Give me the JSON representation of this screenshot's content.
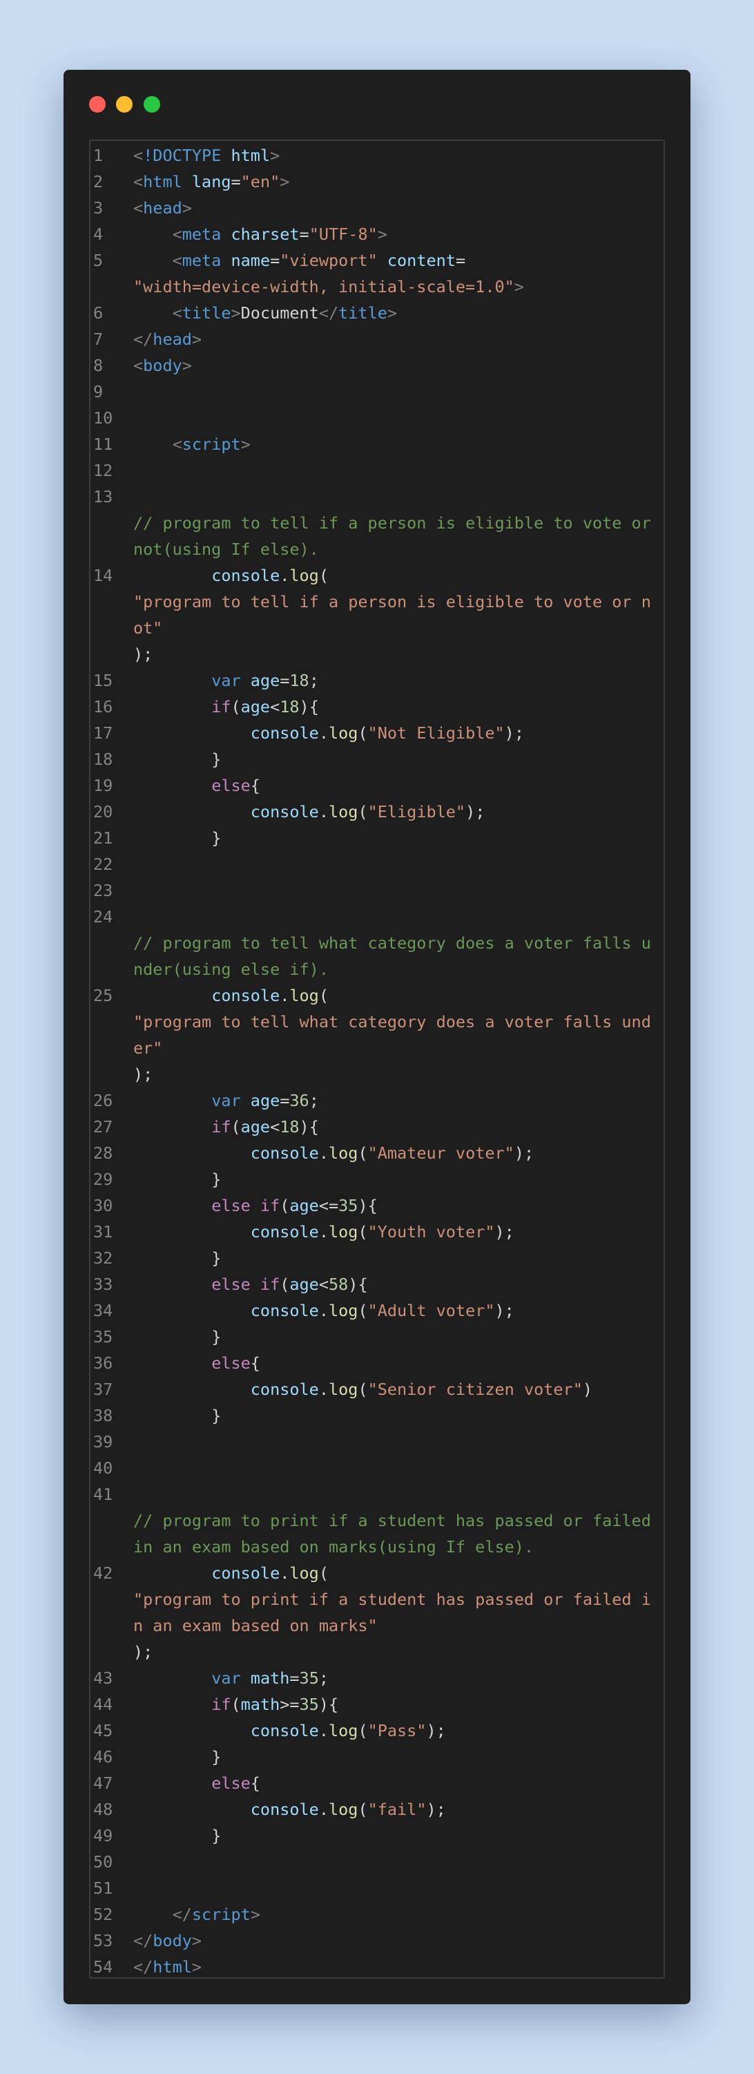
{
  "window": {
    "buttons": [
      "close",
      "minimize",
      "maximize"
    ]
  },
  "editor": {
    "colors": {
      "background": "#1e1e1e",
      "comment": "#6a9955",
      "string": "#ce9178",
      "keyword": "#569cd6",
      "control": "#c586c0",
      "number": "#b5cea8",
      "function": "#dcdcaa",
      "variable": "#9cdcfe"
    },
    "lines": [
      {
        "n": "1",
        "tokens": [
          [
            "bracket",
            "<"
          ],
          [
            "tag",
            "!DOCTYPE"
          ],
          [
            "text",
            " "
          ],
          [
            "attr",
            "html"
          ],
          [
            "bracket",
            ">"
          ]
        ]
      },
      {
        "n": "2",
        "tokens": [
          [
            "bracket",
            "<"
          ],
          [
            "tag",
            "html"
          ],
          [
            "text",
            " "
          ],
          [
            "attr",
            "lang"
          ],
          [
            "punc",
            "="
          ],
          [
            "str",
            "\"en\""
          ],
          [
            "bracket",
            ">"
          ]
        ]
      },
      {
        "n": "3",
        "tokens": [
          [
            "bracket",
            "<"
          ],
          [
            "tag",
            "head"
          ],
          [
            "bracket",
            ">"
          ]
        ]
      },
      {
        "n": "4",
        "tokens": [
          [
            "text",
            "    "
          ],
          [
            "bracket",
            "<"
          ],
          [
            "tag",
            "meta"
          ],
          [
            "text",
            " "
          ],
          [
            "attr",
            "charset"
          ],
          [
            "punc",
            "="
          ],
          [
            "str",
            "\"UTF-8\""
          ],
          [
            "bracket",
            ">"
          ]
        ]
      },
      {
        "n": "5",
        "tokens": [
          [
            "text",
            "    "
          ],
          [
            "bracket",
            "<"
          ],
          [
            "tag",
            "meta"
          ],
          [
            "text",
            " "
          ],
          [
            "attr",
            "name"
          ],
          [
            "punc",
            "="
          ],
          [
            "str",
            "\"viewport\""
          ],
          [
            "text",
            " "
          ],
          [
            "attr",
            "content"
          ],
          [
            "punc",
            "="
          ],
          [
            "text",
            "\n"
          ],
          [
            "str",
            "\"width=device-width, initial-scale=1.0\""
          ],
          [
            "bracket",
            ">"
          ]
        ]
      },
      {
        "n": "6",
        "tokens": [
          [
            "text",
            "    "
          ],
          [
            "bracket",
            "<"
          ],
          [
            "tag",
            "title"
          ],
          [
            "bracket",
            ">"
          ],
          [
            "text",
            "Document"
          ],
          [
            "bracket",
            "</"
          ],
          [
            "tag",
            "title"
          ],
          [
            "bracket",
            ">"
          ]
        ]
      },
      {
        "n": "7",
        "tokens": [
          [
            "bracket",
            "</"
          ],
          [
            "tag",
            "head"
          ],
          [
            "bracket",
            ">"
          ]
        ]
      },
      {
        "n": "8",
        "tokens": [
          [
            "bracket",
            "<"
          ],
          [
            "tag",
            "body"
          ],
          [
            "bracket",
            ">"
          ]
        ]
      },
      {
        "n": "9",
        "tokens": []
      },
      {
        "n": "10",
        "tokens": []
      },
      {
        "n": "11",
        "tokens": [
          [
            "text",
            "    "
          ],
          [
            "bracket",
            "<"
          ],
          [
            "tag",
            "script"
          ],
          [
            "bracket",
            ">"
          ]
        ]
      },
      {
        "n": "12",
        "tokens": []
      },
      {
        "n": "13",
        "tokens": [
          [
            "text",
            "\n"
          ],
          [
            "comment",
            "// program to tell if a person is eligible to vote or not(using If else)."
          ]
        ]
      },
      {
        "n": "14",
        "tokens": [
          [
            "text",
            "        "
          ],
          [
            "obj",
            "console"
          ],
          [
            "punc",
            "."
          ],
          [
            "fn",
            "log"
          ],
          [
            "punc",
            "("
          ],
          [
            "text",
            "\n"
          ],
          [
            "str",
            "\"program to tell if a person is eligible to vote or not\""
          ],
          [
            "text",
            "\n"
          ],
          [
            "punc",
            ");"
          ]
        ]
      },
      {
        "n": "15",
        "tokens": [
          [
            "text",
            "        "
          ],
          [
            "kw",
            "var"
          ],
          [
            "text",
            " "
          ],
          [
            "var",
            "age"
          ],
          [
            "punc",
            "="
          ],
          [
            "num",
            "18"
          ],
          [
            "punc",
            ";"
          ]
        ]
      },
      {
        "n": "16",
        "tokens": [
          [
            "text",
            "        "
          ],
          [
            "ctrl",
            "if"
          ],
          [
            "punc",
            "("
          ],
          [
            "var",
            "age"
          ],
          [
            "punc",
            "<"
          ],
          [
            "num",
            "18"
          ],
          [
            "punc",
            "){"
          ]
        ]
      },
      {
        "n": "17",
        "tokens": [
          [
            "text",
            "            "
          ],
          [
            "obj",
            "console"
          ],
          [
            "punc",
            "."
          ],
          [
            "fn",
            "log"
          ],
          [
            "punc",
            "("
          ],
          [
            "str",
            "\"Not Eligible\""
          ],
          [
            "punc",
            ");"
          ]
        ]
      },
      {
        "n": "18",
        "tokens": [
          [
            "text",
            "        "
          ],
          [
            "punc",
            "}"
          ]
        ]
      },
      {
        "n": "19",
        "tokens": [
          [
            "text",
            "        "
          ],
          [
            "ctrl",
            "else"
          ],
          [
            "punc",
            "{"
          ]
        ]
      },
      {
        "n": "20",
        "tokens": [
          [
            "text",
            "            "
          ],
          [
            "obj",
            "console"
          ],
          [
            "punc",
            "."
          ],
          [
            "fn",
            "log"
          ],
          [
            "punc",
            "("
          ],
          [
            "str",
            "\"Eligible\""
          ],
          [
            "punc",
            ");"
          ]
        ]
      },
      {
        "n": "21",
        "tokens": [
          [
            "text",
            "        "
          ],
          [
            "punc",
            "}"
          ]
        ]
      },
      {
        "n": "22",
        "tokens": []
      },
      {
        "n": "23",
        "tokens": []
      },
      {
        "n": "24",
        "tokens": [
          [
            "text",
            "\n"
          ],
          [
            "comment",
            "// program to tell what category does a voter falls under(using else if)."
          ]
        ]
      },
      {
        "n": "25",
        "tokens": [
          [
            "text",
            "        "
          ],
          [
            "obj",
            "console"
          ],
          [
            "punc",
            "."
          ],
          [
            "fn",
            "log"
          ],
          [
            "punc",
            "("
          ],
          [
            "text",
            "\n"
          ],
          [
            "str",
            "\"program to tell what category does a voter falls under\""
          ],
          [
            "text",
            "\n"
          ],
          [
            "punc",
            ");"
          ]
        ]
      },
      {
        "n": "26",
        "tokens": [
          [
            "text",
            "        "
          ],
          [
            "kw",
            "var"
          ],
          [
            "text",
            " "
          ],
          [
            "var",
            "age"
          ],
          [
            "punc",
            "="
          ],
          [
            "num",
            "36"
          ],
          [
            "punc",
            ";"
          ]
        ]
      },
      {
        "n": "27",
        "tokens": [
          [
            "text",
            "        "
          ],
          [
            "ctrl",
            "if"
          ],
          [
            "punc",
            "("
          ],
          [
            "var",
            "age"
          ],
          [
            "punc",
            "<"
          ],
          [
            "num",
            "18"
          ],
          [
            "punc",
            "){"
          ]
        ]
      },
      {
        "n": "28",
        "tokens": [
          [
            "text",
            "            "
          ],
          [
            "obj",
            "console"
          ],
          [
            "punc",
            "."
          ],
          [
            "fn",
            "log"
          ],
          [
            "punc",
            "("
          ],
          [
            "str",
            "\"Amateur voter\""
          ],
          [
            "punc",
            ");"
          ]
        ]
      },
      {
        "n": "29",
        "tokens": [
          [
            "text",
            "        "
          ],
          [
            "punc",
            "}"
          ]
        ]
      },
      {
        "n": "30",
        "tokens": [
          [
            "text",
            "        "
          ],
          [
            "ctrl",
            "else if"
          ],
          [
            "punc",
            "("
          ],
          [
            "var",
            "age"
          ],
          [
            "punc",
            "<="
          ],
          [
            "num",
            "35"
          ],
          [
            "punc",
            "){"
          ]
        ]
      },
      {
        "n": "31",
        "tokens": [
          [
            "text",
            "            "
          ],
          [
            "obj",
            "console"
          ],
          [
            "punc",
            "."
          ],
          [
            "fn",
            "log"
          ],
          [
            "punc",
            "("
          ],
          [
            "str",
            "\"Youth voter\""
          ],
          [
            "punc",
            ");"
          ]
        ]
      },
      {
        "n": "32",
        "tokens": [
          [
            "text",
            "        "
          ],
          [
            "punc",
            "}"
          ]
        ]
      },
      {
        "n": "33",
        "tokens": [
          [
            "text",
            "        "
          ],
          [
            "ctrl",
            "else if"
          ],
          [
            "punc",
            "("
          ],
          [
            "var",
            "age"
          ],
          [
            "punc",
            "<"
          ],
          [
            "num",
            "58"
          ],
          [
            "punc",
            "){"
          ]
        ]
      },
      {
        "n": "34",
        "tokens": [
          [
            "text",
            "            "
          ],
          [
            "obj",
            "console"
          ],
          [
            "punc",
            "."
          ],
          [
            "fn",
            "log"
          ],
          [
            "punc",
            "("
          ],
          [
            "str",
            "\"Adult voter\""
          ],
          [
            "punc",
            ");"
          ]
        ]
      },
      {
        "n": "35",
        "tokens": [
          [
            "text",
            "        "
          ],
          [
            "punc",
            "}"
          ]
        ]
      },
      {
        "n": "36",
        "tokens": [
          [
            "text",
            "        "
          ],
          [
            "ctrl",
            "else"
          ],
          [
            "punc",
            "{"
          ]
        ]
      },
      {
        "n": "37",
        "tokens": [
          [
            "text",
            "            "
          ],
          [
            "obj",
            "console"
          ],
          [
            "punc",
            "."
          ],
          [
            "fn",
            "log"
          ],
          [
            "punc",
            "("
          ],
          [
            "str",
            "\"Senior citizen voter\""
          ],
          [
            "punc",
            ")"
          ]
        ]
      },
      {
        "n": "38",
        "tokens": [
          [
            "text",
            "        "
          ],
          [
            "punc",
            "}"
          ]
        ]
      },
      {
        "n": "39",
        "tokens": []
      },
      {
        "n": "40",
        "tokens": []
      },
      {
        "n": "41",
        "tokens": [
          [
            "text",
            "\n"
          ],
          [
            "comment",
            "// program to print if a student has passed or failed in an exam based on marks(using If else)."
          ]
        ]
      },
      {
        "n": "42",
        "tokens": [
          [
            "text",
            "        "
          ],
          [
            "obj",
            "console"
          ],
          [
            "punc",
            "."
          ],
          [
            "fn",
            "log"
          ],
          [
            "punc",
            "("
          ],
          [
            "text",
            "\n"
          ],
          [
            "str",
            "\"program to print if a student has passed or failed in an exam based on marks\""
          ],
          [
            "text",
            "\n"
          ],
          [
            "punc",
            ");"
          ]
        ]
      },
      {
        "n": "43",
        "tokens": [
          [
            "text",
            "        "
          ],
          [
            "kw",
            "var"
          ],
          [
            "text",
            " "
          ],
          [
            "var",
            "math"
          ],
          [
            "punc",
            "="
          ],
          [
            "num",
            "35"
          ],
          [
            "punc",
            ";"
          ]
        ]
      },
      {
        "n": "44",
        "tokens": [
          [
            "text",
            "        "
          ],
          [
            "ctrl",
            "if"
          ],
          [
            "punc",
            "("
          ],
          [
            "var",
            "math"
          ],
          [
            "punc",
            ">="
          ],
          [
            "num",
            "35"
          ],
          [
            "punc",
            "){"
          ]
        ]
      },
      {
        "n": "45",
        "tokens": [
          [
            "text",
            "            "
          ],
          [
            "obj",
            "console"
          ],
          [
            "punc",
            "."
          ],
          [
            "fn",
            "log"
          ],
          [
            "punc",
            "("
          ],
          [
            "str",
            "\"Pass\""
          ],
          [
            "punc",
            ");"
          ]
        ]
      },
      {
        "n": "46",
        "tokens": [
          [
            "text",
            "        "
          ],
          [
            "punc",
            "}"
          ]
        ]
      },
      {
        "n": "47",
        "tokens": [
          [
            "text",
            "        "
          ],
          [
            "ctrl",
            "else"
          ],
          [
            "punc",
            "{"
          ]
        ]
      },
      {
        "n": "48",
        "tokens": [
          [
            "text",
            "            "
          ],
          [
            "obj",
            "console"
          ],
          [
            "punc",
            "."
          ],
          [
            "fn",
            "log"
          ],
          [
            "punc",
            "("
          ],
          [
            "str",
            "\"fail\""
          ],
          [
            "punc",
            ");"
          ]
        ]
      },
      {
        "n": "49",
        "tokens": [
          [
            "text",
            "        "
          ],
          [
            "punc",
            "}"
          ]
        ]
      },
      {
        "n": "50",
        "tokens": []
      },
      {
        "n": "51",
        "tokens": []
      },
      {
        "n": "52",
        "tokens": [
          [
            "text",
            "    "
          ],
          [
            "bracket",
            "</"
          ],
          [
            "tag",
            "script"
          ],
          [
            "bracket",
            ">"
          ]
        ]
      },
      {
        "n": "53",
        "tokens": [
          [
            "bracket",
            "</"
          ],
          [
            "tag",
            "body"
          ],
          [
            "bracket",
            ">"
          ]
        ]
      },
      {
        "n": "54",
        "tokens": [
          [
            "bracket",
            "</"
          ],
          [
            "tag",
            "html"
          ],
          [
            "bracket",
            ">"
          ]
        ]
      }
    ]
  }
}
